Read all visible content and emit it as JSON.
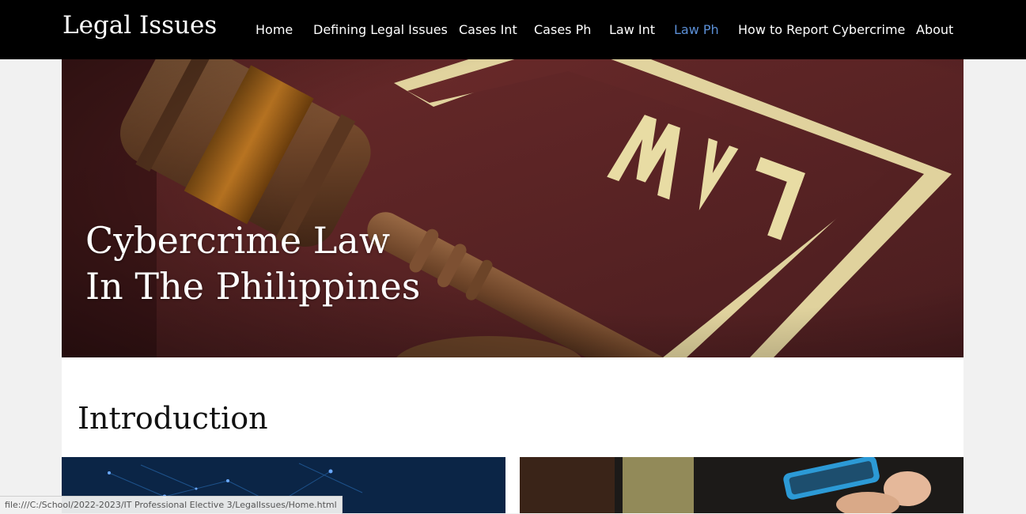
{
  "navbar": {
    "brand": "Legal Issues",
    "items": [
      {
        "label": "Home",
        "active": false
      },
      {
        "label": "Defining Legal Issues",
        "active": false
      },
      {
        "label": "Cases Int",
        "active": false
      },
      {
        "label": "Cases Ph",
        "active": false
      },
      {
        "label": "Law Int",
        "active": false
      },
      {
        "label": "Law Ph",
        "active": true
      },
      {
        "label": "How to Report Cybercrime",
        "active": false
      },
      {
        "label": "About",
        "active": false
      }
    ],
    "active_color": "#5b8fd6"
  },
  "hero": {
    "title_line1": "Cybercrime Law",
    "title_line2": "In The Philippines",
    "image": "gavel-on-law-book",
    "book_text": "LAW"
  },
  "main": {
    "heading": "Introduction",
    "cards": [
      {
        "image": "digital-network-image"
      },
      {
        "image": "hand-holding-phone-image"
      }
    ]
  },
  "status_bar": {
    "url": "file:///C:/School/2022-2023/IT Professional Elective 3/LegalIssues/Home.html"
  }
}
